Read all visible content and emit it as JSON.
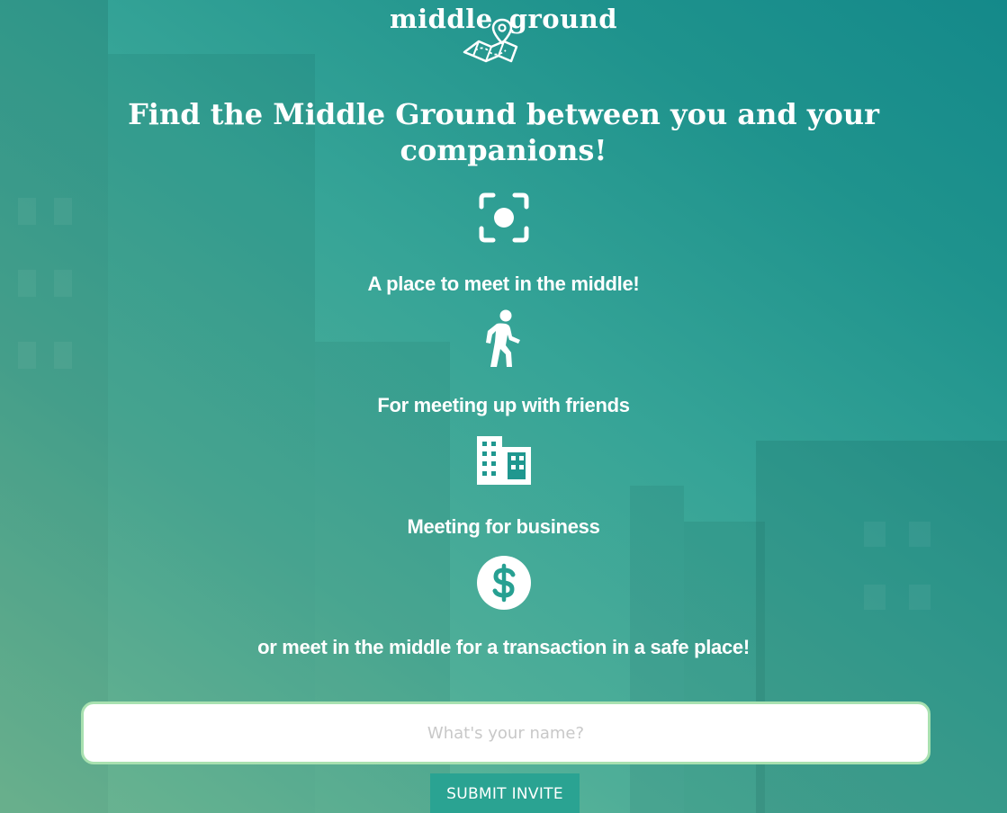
{
  "logo": {
    "text_left": "middle",
    "text_right": "ground",
    "icon": "map-pin-icon"
  },
  "headline": {
    "line1": "Find the Middle Ground between you and your",
    "line2": "companions!"
  },
  "features": [
    {
      "icon": "center-focus-icon",
      "text": "A place to meet in the middle!"
    },
    {
      "icon": "walking-person-icon",
      "text": "For meeting up with friends"
    },
    {
      "icon": "office-building-icon",
      "text": "Meeting for business"
    },
    {
      "icon": "dollar-circle-icon",
      "text": "or meet in the middle for a transaction in a safe place!"
    }
  ],
  "form": {
    "name_placeholder": "What's your name?",
    "name_value": "",
    "submit_label": "SUBMIT INVITE"
  },
  "colors": {
    "accent": "#2aa392",
    "input_border": "#a8e1b0",
    "gradient_start": "#7cc39a",
    "gradient_end": "#14898a"
  }
}
